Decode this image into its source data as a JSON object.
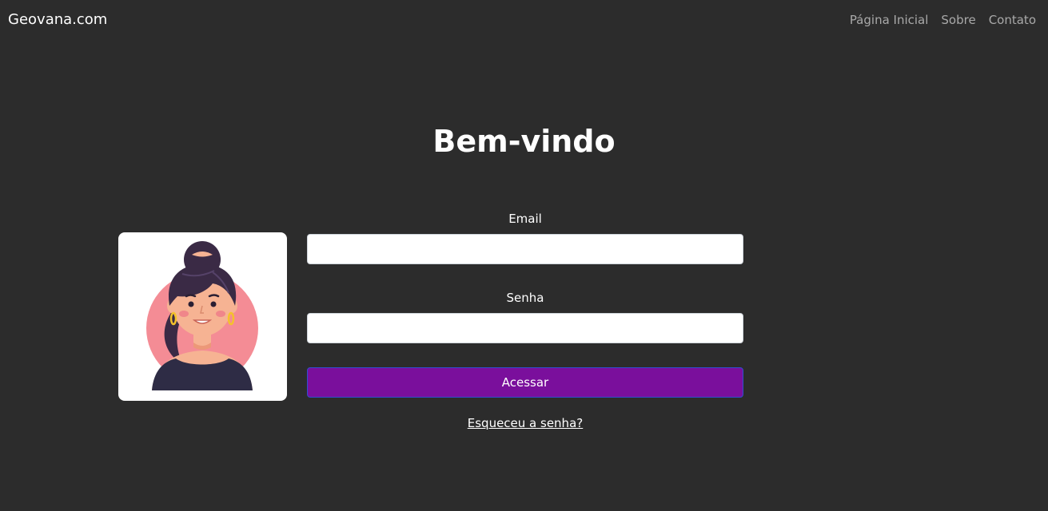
{
  "navbar": {
    "brand": "Geovana.com",
    "links": [
      "Página Inicial",
      "Sobre",
      "Contato"
    ]
  },
  "main": {
    "title": "Bem-vindo",
    "email_label": "Email",
    "email_value": "",
    "password_label": "Senha",
    "password_value": "",
    "submit_label": "Acessar",
    "forgot_label": "Esqueceu a senha?"
  },
  "colors": {
    "background": "#2c2c2c",
    "button": "#7a0f9c",
    "nav_link": "#a9a9a9"
  },
  "icons": {
    "avatar": "woman-avatar-illustration"
  }
}
